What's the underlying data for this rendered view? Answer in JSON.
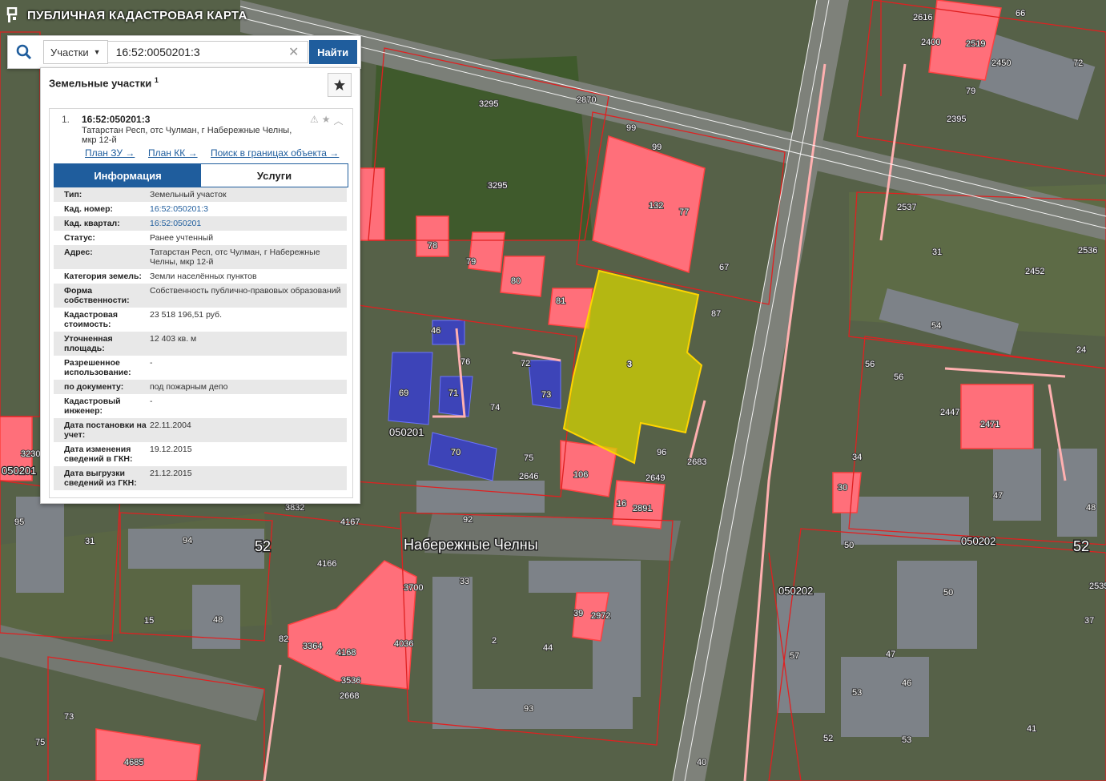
{
  "header": {
    "title": "ПУБЛИЧНАЯ КАДАСТРОВАЯ КАРТА",
    "logo_icon": "map-logo-icon"
  },
  "search": {
    "type_label": "Участки",
    "value": "16:52:0050201:3",
    "button_label": "Найти"
  },
  "panel": {
    "title": "Земельные участки",
    "count": "1",
    "result": {
      "index": "1.",
      "cad_number": "16:52:050201:3",
      "address": "Татарстан Респ, отс Чулман, г Набережные Челны, мкр 12-й",
      "links": [
        "План ЗУ →",
        "План КК →",
        "Поиск в границах объекта →"
      ]
    },
    "tabs": [
      "Информация",
      "Услуги"
    ],
    "info": [
      {
        "key": "Тип:",
        "value": "Земельный участок"
      },
      {
        "key": "Кад. номер:",
        "value": "16:52:050201:3"
      },
      {
        "key": "Кад. квартал:",
        "value": "16:52:050201"
      },
      {
        "key": "Статус:",
        "value": "Ранее учтенный"
      },
      {
        "key": "Адрес:",
        "value": "Татарстан Респ, отс Чулман, г Набережные Челны, мкр 12-й"
      },
      {
        "key": "Категория земель:",
        "value": "Земли населённых пунктов"
      },
      {
        "key": "Форма собственности:",
        "value": "Собственность публично-правовых образований"
      },
      {
        "key": "Кадастровая стоимость:",
        "value": "23 518 196,51 руб."
      },
      {
        "key": "Уточненная площадь:",
        "value": "12 403 кв. м"
      },
      {
        "key": "Разрешенное использование:",
        "value": "-"
      },
      {
        "key": "по документу:",
        "value": "под пожарным депо"
      },
      {
        "key": "Кадастровый инженер:",
        "value": "-"
      },
      {
        "key": "Дата постановки на учет:",
        "value": "22.11.2004"
      },
      {
        "key": "Дата изменения сведений в ГКН:",
        "value": "19.12.2015"
      },
      {
        "key": "Дата выгрузки сведений из ГКН:",
        "value": "21.12.2015"
      }
    ]
  },
  "map": {
    "city_label": "Набережные Челны",
    "selected_parcel": "3",
    "quarters": [
      "050201",
      "050201",
      "050202",
      "050202",
      "050201",
      "52",
      "52"
    ],
    "parcel_labels": [
      "3295",
      "3295",
      "2870",
      "99",
      "99",
      "132",
      "77",
      "67",
      "87",
      "96",
      "2683",
      "2649",
      "2891",
      "16",
      "106",
      "75",
      "2646",
      "74",
      "73",
      "72",
      "71",
      "69",
      "70",
      "76",
      "46",
      "78",
      "79",
      "80",
      "81",
      "92",
      "3832",
      "4167",
      "4166",
      "94",
      "31",
      "15",
      "48",
      "82",
      "3364",
      "4168",
      "4036",
      "3700",
      "3536",
      "2668",
      "33",
      "2",
      "44",
      "39",
      "2972",
      "93",
      "73",
      "75",
      "4685",
      "95",
      "3230",
      "2616",
      "2400",
      "2519",
      "2450",
      "66",
      "72",
      "79",
      "2395",
      "2537",
      "31",
      "2536",
      "2452",
      "54",
      "56",
      "56",
      "24",
      "2447",
      "2471",
      "34",
      "30",
      "47",
      "48",
      "50",
      "50",
      "57",
      "46",
      "53",
      "52",
      "53",
      "41",
      "37",
      "2535",
      "40",
      "47",
      "3295"
    ],
    "colors": {
      "parcel_stroke": "#e02020",
      "parcel_fill": "#ff6f7a",
      "selected_fill": "#d4d400",
      "accent": "#1f5d9d"
    }
  }
}
